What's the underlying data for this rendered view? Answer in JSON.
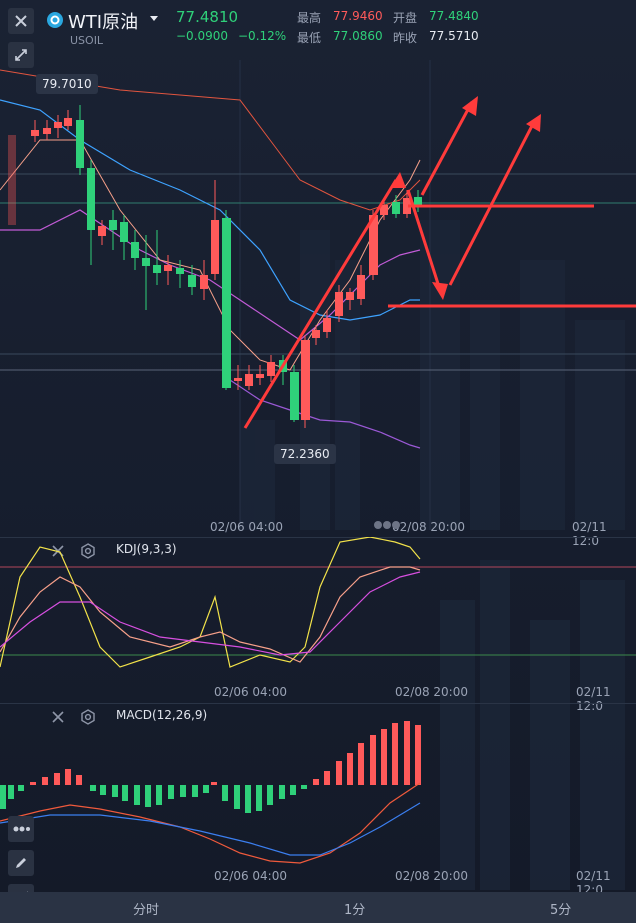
{
  "header": {
    "symbol": "WTI原油",
    "code": "USOIL",
    "last_price": "77.4810",
    "change": "−0.0900",
    "change_pct": "−0.12%",
    "high_label": "最高",
    "high_value": "77.9460",
    "open_label": "开盘",
    "open_value": "77.4840",
    "low_label": "最低",
    "low_value": "77.0860",
    "prev_close_label": "昨收",
    "prev_close_value": "77.5710"
  },
  "price_tags": {
    "high_tag": "79.7010",
    "low_tag": "72.2360"
  },
  "time_axis": [
    "02/06 04:00",
    "02/08 20:00",
    "02/11 12:0"
  ],
  "indicators": {
    "kdj_title": "KDJ(9,3,3)",
    "macd_title": "MACD(12,26,9)"
  },
  "bottom_tabs": [
    "分时",
    "1分",
    "5分"
  ],
  "colors": {
    "up": "#ff5a5a",
    "down": "#2fd17a",
    "background": "#161d2d"
  },
  "icons": [
    "close-icon",
    "collapse-icon",
    "symbol-badge-icon",
    "dropdown-icon",
    "eye-icon",
    "gear-icon",
    "pencil-icon",
    "draw-line-icon",
    "more-dots-icon"
  ]
}
